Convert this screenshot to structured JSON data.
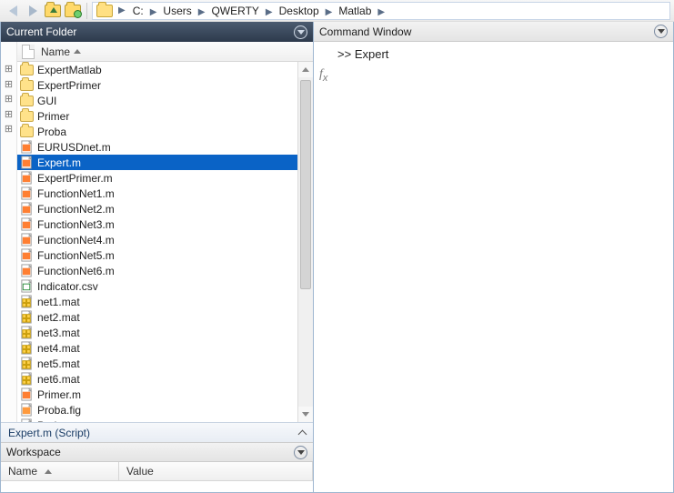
{
  "breadcrumbs": [
    "C:",
    "Users",
    "QWERTY",
    "Desktop",
    "Matlab"
  ],
  "currentFolder": {
    "title": "Current Folder",
    "nameHeader": "Name",
    "folders": [
      "ExpertMatlab",
      "ExpertPrimer",
      "GUI",
      "Primer",
      "Proba"
    ],
    "files": [
      {
        "name": "EURUSDnet.m",
        "type": "m"
      },
      {
        "name": "Expert.m",
        "type": "m",
        "selected": true
      },
      {
        "name": "ExpertPrimer.m",
        "type": "m"
      },
      {
        "name": "FunctionNet1.m",
        "type": "m"
      },
      {
        "name": "FunctionNet2.m",
        "type": "m"
      },
      {
        "name": "FunctionNet3.m",
        "type": "m"
      },
      {
        "name": "FunctionNet4.m",
        "type": "m"
      },
      {
        "name": "FunctionNet5.m",
        "type": "m"
      },
      {
        "name": "FunctionNet6.m",
        "type": "m"
      },
      {
        "name": "Indicator.csv",
        "type": "csv"
      },
      {
        "name": "net1.mat",
        "type": "mat"
      },
      {
        "name": "net2.mat",
        "type": "mat"
      },
      {
        "name": "net3.mat",
        "type": "mat"
      },
      {
        "name": "net4.mat",
        "type": "mat"
      },
      {
        "name": "net5.mat",
        "type": "mat"
      },
      {
        "name": "net6.mat",
        "type": "mat"
      },
      {
        "name": "Primer.m",
        "type": "m"
      },
      {
        "name": "Proba.fig",
        "type": "fig"
      },
      {
        "name": "Proba.m",
        "type": "m"
      }
    ],
    "detailsLabel": "Expert.m  (Script)"
  },
  "workspace": {
    "title": "Workspace",
    "cols": [
      "Name",
      "Value"
    ]
  },
  "commandWindow": {
    "title": "Command Window",
    "promptPrefix": ">>",
    "input": "Expert"
  }
}
